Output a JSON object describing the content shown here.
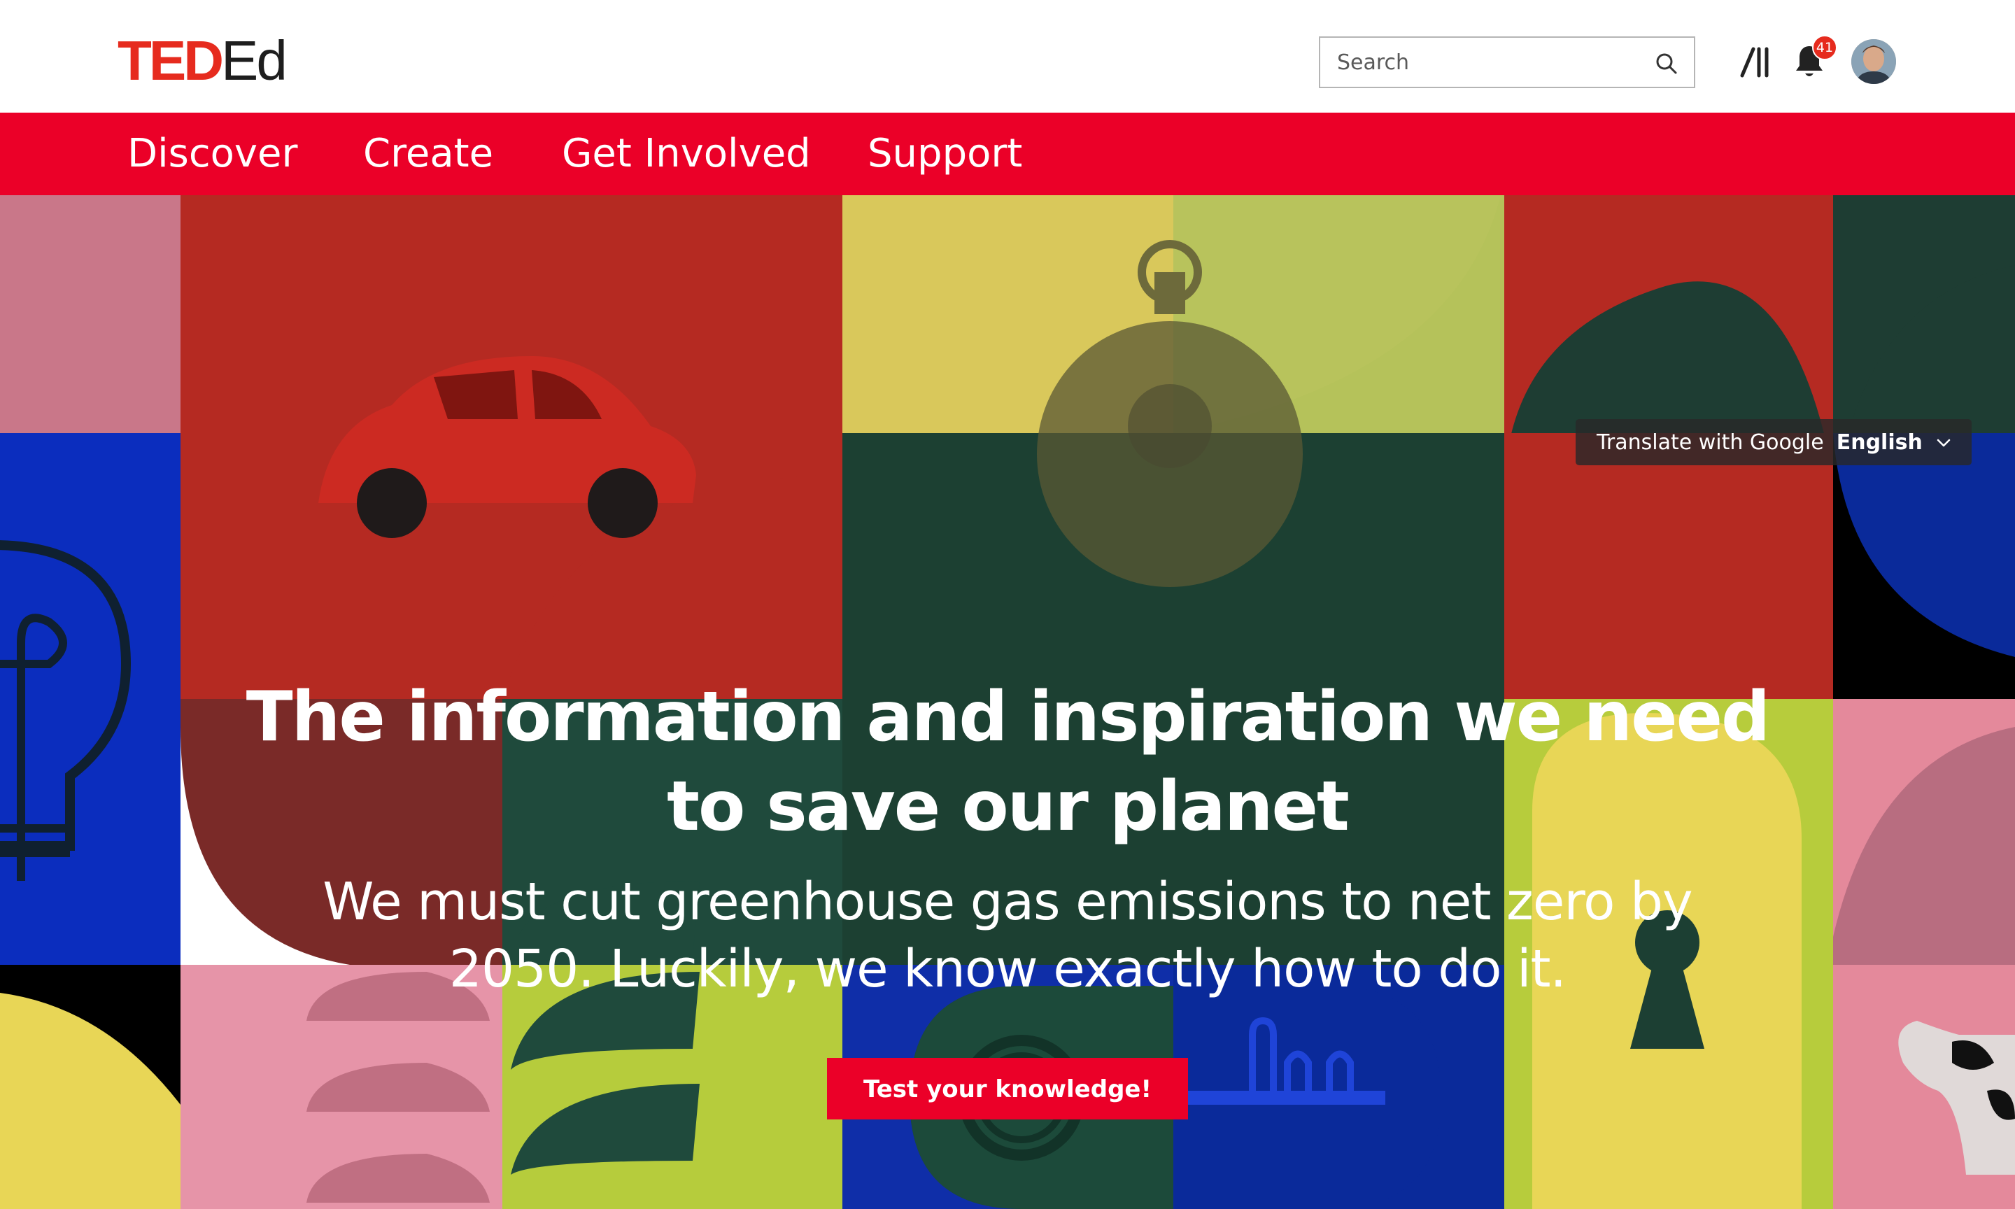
{
  "brand": {
    "logo_ted": "TED",
    "logo_ed": "Ed"
  },
  "search": {
    "placeholder": "Search",
    "value": ""
  },
  "header": {
    "notification_count": "41"
  },
  "nav": {
    "items": [
      "Discover",
      "Create",
      "Get Involved",
      "Support"
    ]
  },
  "translate": {
    "label": "Translate with Google",
    "language": "English"
  },
  "hero": {
    "headline_line1": "The information and inspiration we need",
    "headline_line2": "to save our planet",
    "subheadline_line1": "We must cut greenhouse gas emissions to net zero by",
    "subheadline_line2": "2050. Luckily, we know exactly how to do it.",
    "cta_label": "Test your knowledge!"
  },
  "colors": {
    "brand_red": "#eb0028",
    "ted_red": "#e62b1e",
    "nav_text": "#ffffff",
    "hero_text": "#ffffff"
  },
  "icons": {
    "search": "search-icon",
    "library": "library-icon",
    "notifications": "bell-icon",
    "dropdown": "chevron-down-icon"
  }
}
